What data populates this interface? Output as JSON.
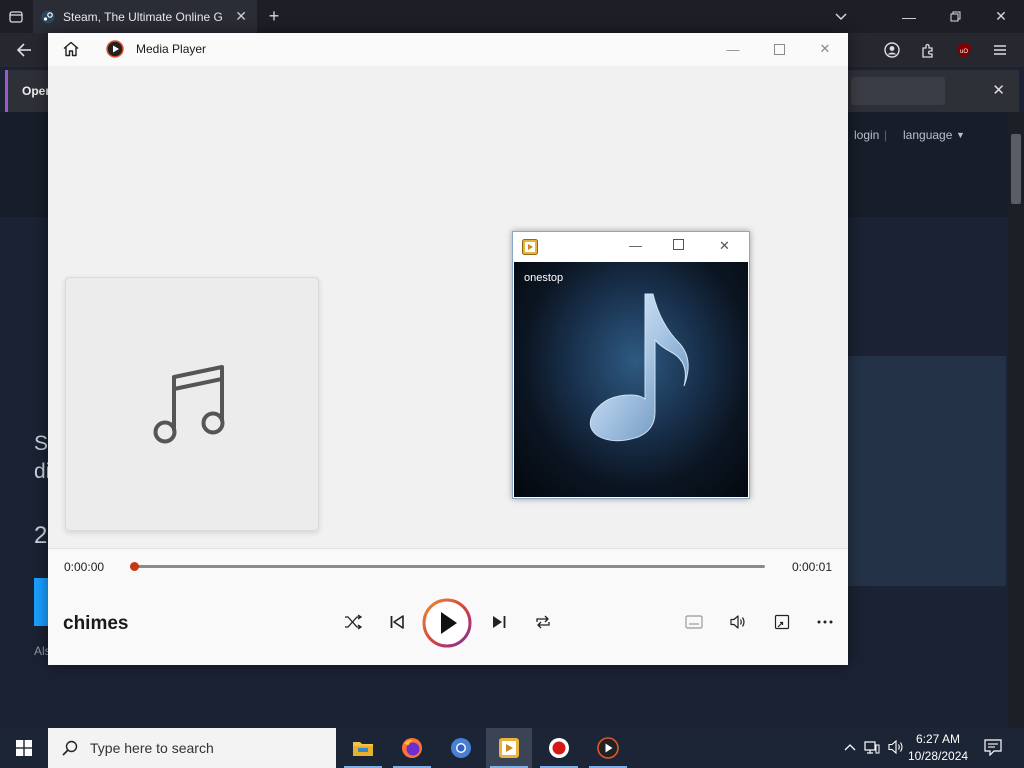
{
  "browser": {
    "tab_title": "Steam, The Ultimate Online Game Platform",
    "notice_text": "Oper"
  },
  "steam": {
    "nav_login": "login",
    "nav_language": "language",
    "frag_st": "St",
    "frag_di": "di",
    "frag_2": "2",
    "frag_als": "Als"
  },
  "media_player": {
    "app_name": "Media Player",
    "current_time": "0:00:00",
    "total_time": "0:00:01",
    "progress_fraction": 0.0,
    "song_title": "chimes"
  },
  "popup": {
    "overlay_text": "onestop"
  },
  "taskbar": {
    "search_placeholder": "Type here to search",
    "time": "6:27 AM",
    "date": "10/28/2024"
  },
  "colors": {
    "accent_play_ring": "#e0552b",
    "seek_knob": "#c8380e",
    "taskbar_bg": "#1c2535"
  }
}
